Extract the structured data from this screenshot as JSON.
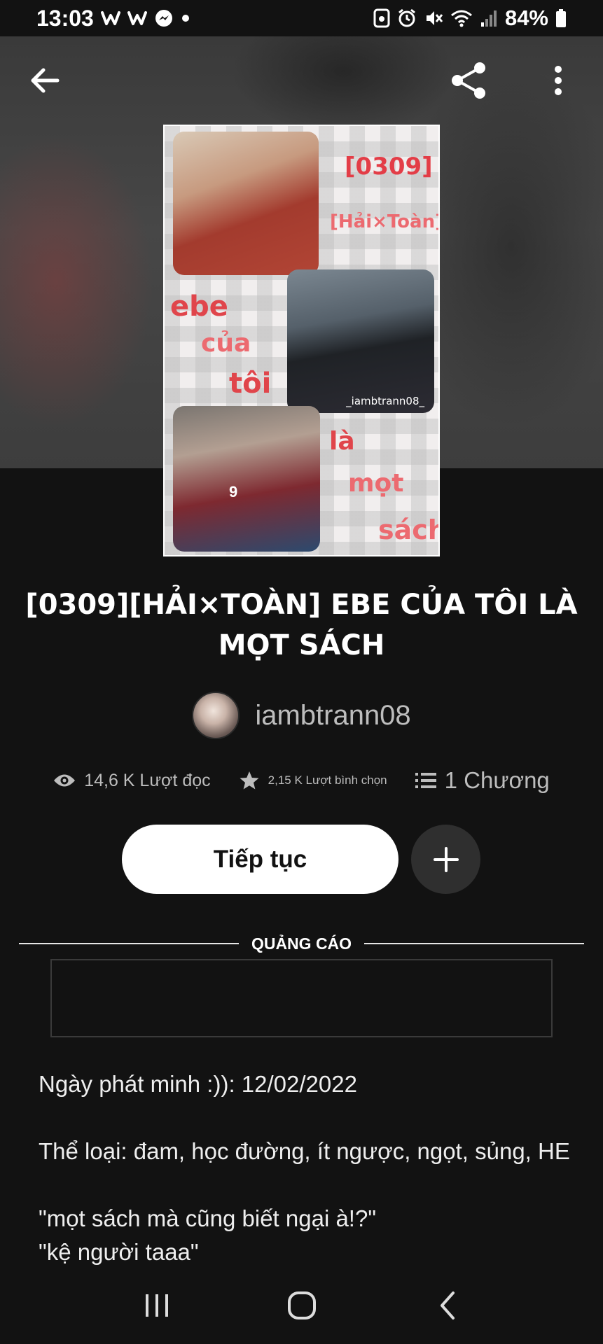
{
  "status_bar": {
    "time": "13:03",
    "notification_icons": [
      "w-icon",
      "w-icon",
      "messenger-icon",
      "dot-icon"
    ],
    "system_icons": [
      "screenshot-icon",
      "alarm-icon",
      "mute-icon",
      "wifi-icon",
      "signal-icon"
    ],
    "battery": "84%"
  },
  "cover": {
    "code": "[0309]",
    "pair": "[Hải×Toàn]",
    "word_ebe": "ebe",
    "word_cua": "của",
    "word_toi": "tôi",
    "word_la": "là",
    "word_mot": "mọt",
    "word_sach": "sách",
    "photo_tag": "_iambtrann08_",
    "jersey_number": "9"
  },
  "story": {
    "title": "[0309][HẢI×TOÀN] EBE CỦA TÔI LÀ MỌT SÁCH",
    "author": "iambtrann08",
    "reads": "14,6 K Lượt đọc",
    "votes": "2,15 K Lượt bình chọn",
    "parts": "1 Chương"
  },
  "actions": {
    "continue_label": "Tiếp tục"
  },
  "ad": {
    "label": "QUẢNG CÁO"
  },
  "description": {
    "line1": "Ngày phát minh :)): 12/02/2022",
    "line2": "Thể loại: đam, học đường, ít ngược, ngọt, sủng, HE",
    "line3": "\"mọt sách mà cũng biết ngại à!?\"",
    "line4": "\"kệ người taaa\""
  }
}
